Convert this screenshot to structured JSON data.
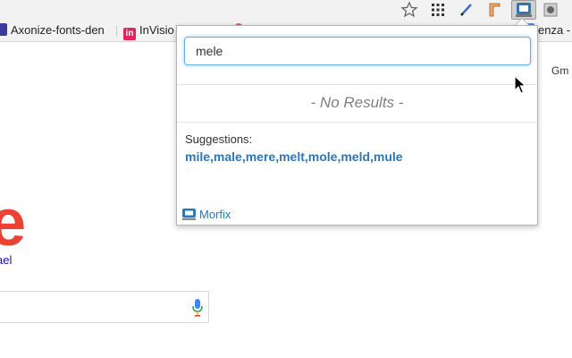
{
  "bookmarks": {
    "item1": "Axonize-fonts-den",
    "item2_icon_text": "in",
    "item2": "InVisio",
    "item3": "enza -"
  },
  "page": {
    "gm_label": "Gm",
    "logo_letter": "e",
    "link_text": "ael"
  },
  "popup": {
    "query_value": "mele",
    "no_results": "- No Results -",
    "suggestions_label": "Suggestions:",
    "suggestions": [
      "mile",
      "male",
      "mere",
      "melt",
      "mole",
      "meld",
      "mule"
    ],
    "footer_label": "Morfix"
  },
  "colors": {
    "link_blue": "#2f76b5",
    "input_focus": "#66afe9",
    "google_red": "#ea4335"
  },
  "icons": {
    "toolbar": [
      "star-icon",
      "apps-grid-icon",
      "pen-icon",
      "ruler-icon",
      "morfix-extension-icon",
      "stamp-icon"
    ],
    "mic": "microphone-icon",
    "cursor": "mouse-pointer-icon"
  }
}
